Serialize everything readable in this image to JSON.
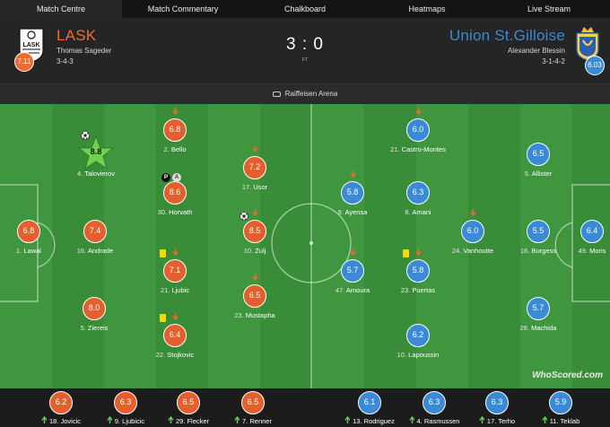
{
  "nav": {
    "tabs": [
      "Match Centre",
      "Match Commentary",
      "Chalkboard",
      "Heatmaps",
      "Live Stream"
    ],
    "active": 0
  },
  "home": {
    "name": "LASK",
    "manager": "Thomas Sageder",
    "formation": "3-4-3",
    "rating": "7.11",
    "color": "#f26a2f",
    "crest_text": "LASK"
  },
  "away": {
    "name": "Union St.Gilloise",
    "manager": "Alexander Blessin",
    "formation": "3-1-4-2",
    "rating": "6.03",
    "color": "#3a8ad6"
  },
  "score": "3 : 0",
  "status": "FT",
  "venue": "Raiffeisen Arena",
  "watermark": "WhoScored.com",
  "home_players": [
    {
      "num": "1.",
      "name": "Lawal",
      "rating": "6.8"
    },
    {
      "num": "16.",
      "name": "Andrade",
      "rating": "7.4"
    },
    {
      "num": "4.",
      "name": "Talovierov",
      "rating": "8.8",
      "motm": true,
      "goal": true
    },
    {
      "num": "5.",
      "name": "Ziereis",
      "rating": "8.0"
    },
    {
      "num": "2.",
      "name": "Bello",
      "rating": "6.8",
      "subbed_off": true
    },
    {
      "num": "30.",
      "name": "Horvath",
      "rating": "8.6",
      "penalty": true,
      "assist": true
    },
    {
      "num": "21.",
      "name": "Ljubic",
      "rating": "7.1",
      "yellow": true,
      "subbed_off": true
    },
    {
      "num": "22.",
      "name": "Stojkovic",
      "rating": "6.4",
      "yellow": true,
      "subbed_off": true
    },
    {
      "num": "17.",
      "name": "Usor",
      "rating": "7.2",
      "subbed_off": true
    },
    {
      "num": "10.",
      "name": "Zulj",
      "rating": "8.5",
      "goal": true,
      "subbed_off": true
    },
    {
      "num": "23.",
      "name": "Mustapha",
      "rating": "6.5",
      "subbed_off": true
    }
  ],
  "away_players": [
    {
      "num": "49.",
      "name": "Moris",
      "rating": "6.4"
    },
    {
      "num": "5.",
      "name": "Allister",
      "rating": "6.5"
    },
    {
      "num": "16.",
      "name": "Burgess",
      "rating": "5.5"
    },
    {
      "num": "28.",
      "name": "Machida",
      "rating": "5.7"
    },
    {
      "num": "24.",
      "name": "Vanhoutte",
      "rating": "6.0",
      "subbed_off": true
    },
    {
      "num": "21.",
      "name": "Castro-Montes",
      "rating": "6.0",
      "subbed_off": true
    },
    {
      "num": "8.",
      "name": "Amani",
      "rating": "6.3"
    },
    {
      "num": "23.",
      "name": "Puertas",
      "rating": "5.8",
      "yellow": true,
      "subbed_off": true
    },
    {
      "num": "10.",
      "name": "Lapoussin",
      "rating": "6.2"
    },
    {
      "num": "9.",
      "name": "Ayensa",
      "rating": "5.8",
      "subbed_off": true
    },
    {
      "num": "47.",
      "name": "Amoura",
      "rating": "5.7",
      "subbed_off": true
    }
  ],
  "home_subs": [
    {
      "num": "18.",
      "name": "Jovicic",
      "rating": "6.2"
    },
    {
      "num": "9.",
      "name": "Ljubicic",
      "rating": "6.3"
    },
    {
      "num": "29.",
      "name": "Flecker",
      "rating": "6.5"
    },
    {
      "num": "7.",
      "name": "Renner",
      "rating": "6.5"
    }
  ],
  "away_subs": [
    {
      "num": "13.",
      "name": "Rodriguez",
      "rating": "6.1"
    },
    {
      "num": "4.",
      "name": "Rasmussen",
      "rating": "6.3"
    },
    {
      "num": "17.",
      "name": "Terho",
      "rating": "6.3"
    },
    {
      "num": "11.",
      "name": "Teklab",
      "rating": "5.9"
    }
  ],
  "colors": {
    "home": "#e35f2e",
    "away": "#3a8ad6",
    "motm": "#6fd14c",
    "pitch": "#3f963f",
    "sub_on": "#5fd35f",
    "sub_off": "#f26a2f",
    "yellow": "#f5d90a"
  }
}
